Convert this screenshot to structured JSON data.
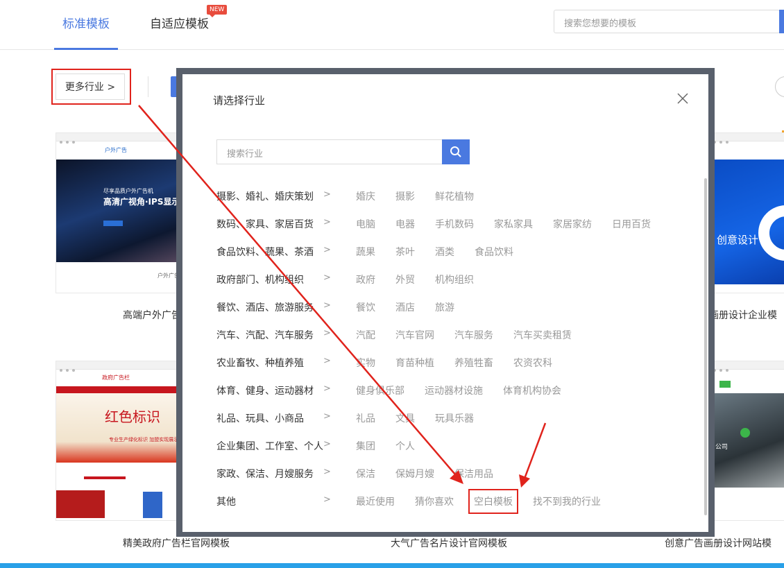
{
  "top_tabs": {
    "standard": "标准模板",
    "adaptive": "自适应模板",
    "new_badge": "NEW"
  },
  "top_search": {
    "placeholder": "搜索您想要的模板"
  },
  "filter": {
    "more_industry": "更多行业 >"
  },
  "cards": [
    {
      "title": "高端户外广告",
      "header": "户外广告",
      "hero_small": "尽享品质户外广告机",
      "hero_big": "高清广视角·IPS显示",
      "sub": "户外广告"
    },
    {
      "title": "精美政府广告栏官网模板",
      "header": "政府广告栏",
      "calligraphy": "红色标识",
      "tagline": "专业生产绿化标识 加盟实现展示平"
    },
    {
      "title": "大气广告名片设计官网模板"
    },
    {
      "title": "画册设计企业模",
      "hero_text": "创意设计"
    },
    {
      "title": "创意广告画册设计网站模",
      "hero_text": "公司"
    }
  ],
  "modal": {
    "title": "请选择行业",
    "search_placeholder": "搜索行业",
    "rows": [
      {
        "category": "摄影、婚礼、婚庆策划",
        "tags": [
          "婚庆",
          "摄影",
          "鲜花植物"
        ]
      },
      {
        "category": "数码、家具、家居百货",
        "tags": [
          "电脑",
          "电器",
          "手机数码",
          "家私家具",
          "家居家纺",
          "日用百货"
        ]
      },
      {
        "category": "食品饮料、蔬果、茶酒",
        "tags": [
          "蔬果",
          "茶叶",
          "酒类",
          "食品饮料"
        ]
      },
      {
        "category": "政府部门、机构组织",
        "tags": [
          "政府",
          "外贸",
          "机构组织"
        ]
      },
      {
        "category": "餐饮、酒店、旅游服务",
        "tags": [
          "餐饮",
          "酒店",
          "旅游"
        ]
      },
      {
        "category": "汽车、汽配、汽车服务",
        "tags": [
          "汽配",
          "汽车官网",
          "汽车服务",
          "汽车买卖租赁"
        ]
      },
      {
        "category": "农业畜牧、种植养殖",
        "tags": [
          "实物",
          "育苗种植",
          "养殖牲畜",
          "农资农科"
        ]
      },
      {
        "category": "体育、健身、运动器材",
        "tags": [
          "健身俱乐部",
          "运动器材设施",
          "体育机构协会"
        ]
      },
      {
        "category": "礼品、玩具、小商品",
        "tags": [
          "礼品",
          "文具",
          "玩具乐器"
        ]
      },
      {
        "category": "企业集团、工作室、个人",
        "tags": [
          "集团",
          "个人"
        ]
      },
      {
        "category": "家政、保洁、月嫂服务",
        "tags": [
          "保洁",
          "保姆月嫂",
          "保洁用品"
        ]
      },
      {
        "category": "其他",
        "tags": [
          "最近使用",
          "猜你喜欢",
          "空白模板",
          "找不到我的行业"
        ]
      }
    ],
    "row_arrow": ">"
  },
  "colors": {
    "accent": "#4a79e0",
    "highlight": "#e0231c",
    "new_badge": "#e84c3d"
  }
}
